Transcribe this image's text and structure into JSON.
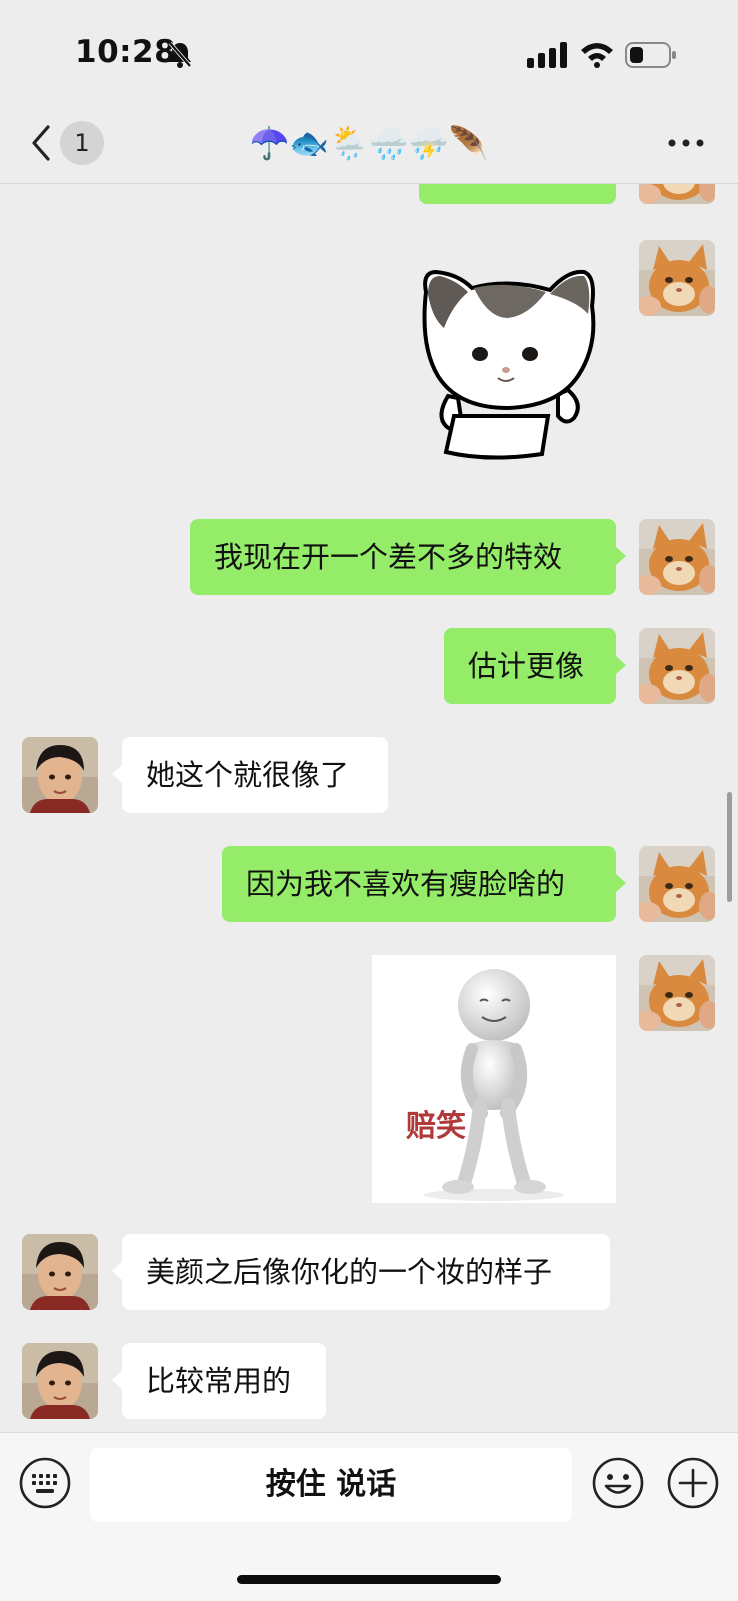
{
  "status_bar": {
    "time": "10:28",
    "signal_icon": "signal-icon",
    "wifi_icon": "wifi-icon",
    "battery_icon": "battery-icon",
    "battery_level": 0.3,
    "bell_icon": "bell-slash-icon"
  },
  "nav": {
    "back_icon": "chevron-left-icon",
    "unread_count": "1",
    "title": "☂️🐟🌦️🌧️⛈️🪶",
    "more_icon": "more-icon"
  },
  "messages": {
    "m1": {
      "sender": "me",
      "type": "text",
      "text": ""
    },
    "m2": {
      "sender": "me",
      "type": "sticker",
      "sticker": "cat-sticker"
    },
    "m3": {
      "sender": "me",
      "type": "text",
      "text": "我现在开一个差不多的特效"
    },
    "m4": {
      "sender": "me",
      "type": "text",
      "text": "估计更像"
    },
    "m5": {
      "sender": "other",
      "type": "text",
      "text": "她这个就很像了"
    },
    "m6": {
      "sender": "me",
      "type": "text",
      "text": "因为我不喜欢有瘦脸啥的"
    },
    "m7": {
      "sender": "me",
      "type": "sticker",
      "sticker_text": "赔笑"
    },
    "m8": {
      "sender": "other",
      "type": "text",
      "text": "美颜之后像你化的一个妆的样子"
    },
    "m9": {
      "sender": "other",
      "type": "text",
      "text": "比较常用的"
    }
  },
  "input": {
    "hold_to_talk_label": "按住 说话",
    "keyboard_icon": "keyboard-icon",
    "emoji_icon": "emoji-icon",
    "plus_icon": "plus-icon"
  },
  "colors": {
    "my_bubble": "#95ec69",
    "their_bubble": "#ffffff",
    "background": "#ededed"
  }
}
